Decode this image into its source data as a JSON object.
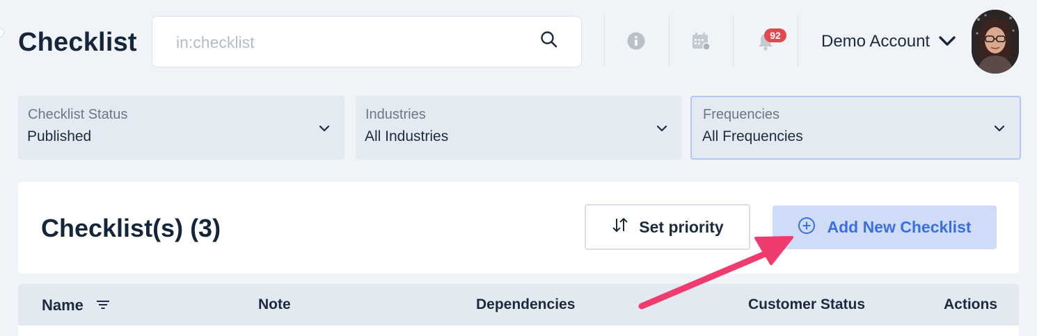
{
  "header": {
    "title": "Checklist",
    "search_placeholder": "in:checklist",
    "notification_count": "92",
    "account_name": "Demo Account"
  },
  "filters": [
    {
      "label": "Checklist Status",
      "value": "Published"
    },
    {
      "label": "Industries",
      "value": "All Industries"
    },
    {
      "label": "Frequencies",
      "value": "All Frequencies"
    }
  ],
  "card": {
    "title": "Checklist(s) (3)",
    "set_priority_label": "Set priority",
    "add_new_label": "Add New Checklist"
  },
  "table": {
    "columns": [
      "Name",
      "Note",
      "Dependencies",
      "Customer Status",
      "Actions"
    ]
  },
  "colors": {
    "background": "#f0f4f8",
    "accent": "#3b6fde",
    "badge": "#e04a4f",
    "annotation_arrow": "#f03b6e"
  },
  "icons": [
    "search-icon",
    "info-icon",
    "calendar-icon",
    "bell-icon",
    "chevron-down-icon",
    "sort-arrows-icon",
    "plus-circle-icon",
    "filter-lines-icon"
  ]
}
